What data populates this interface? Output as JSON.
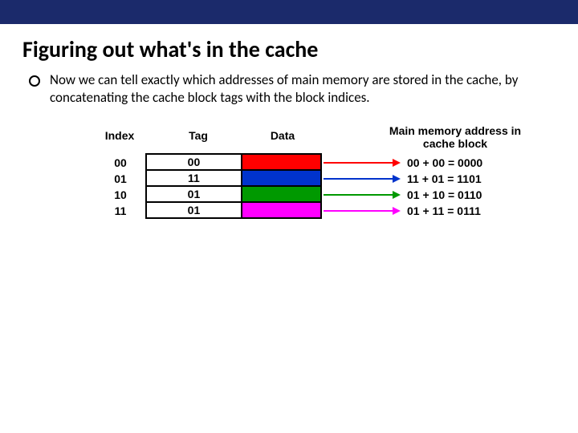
{
  "title": "Figuring out what's in the cache",
  "paragraph": "Now we can tell exactly which addresses of main memory are stored in the cache, by concatenating the cache block tags with the block indices.",
  "headers": {
    "index": "Index",
    "tag": "Tag",
    "data": "Data",
    "main": "Main memory address in cache block"
  },
  "rows": [
    {
      "index": "00",
      "tag": "00",
      "color": "red",
      "addr": "00 + 00 = 0000"
    },
    {
      "index": "01",
      "tag": "11",
      "color": "blue",
      "addr": "11 + 01 = 1101"
    },
    {
      "index": "10",
      "tag": "01",
      "color": "green",
      "addr": "01 + 10 = 0110"
    },
    {
      "index": "11",
      "tag": "01",
      "color": "magenta",
      "addr": "01 + 11 = 0111"
    }
  ]
}
